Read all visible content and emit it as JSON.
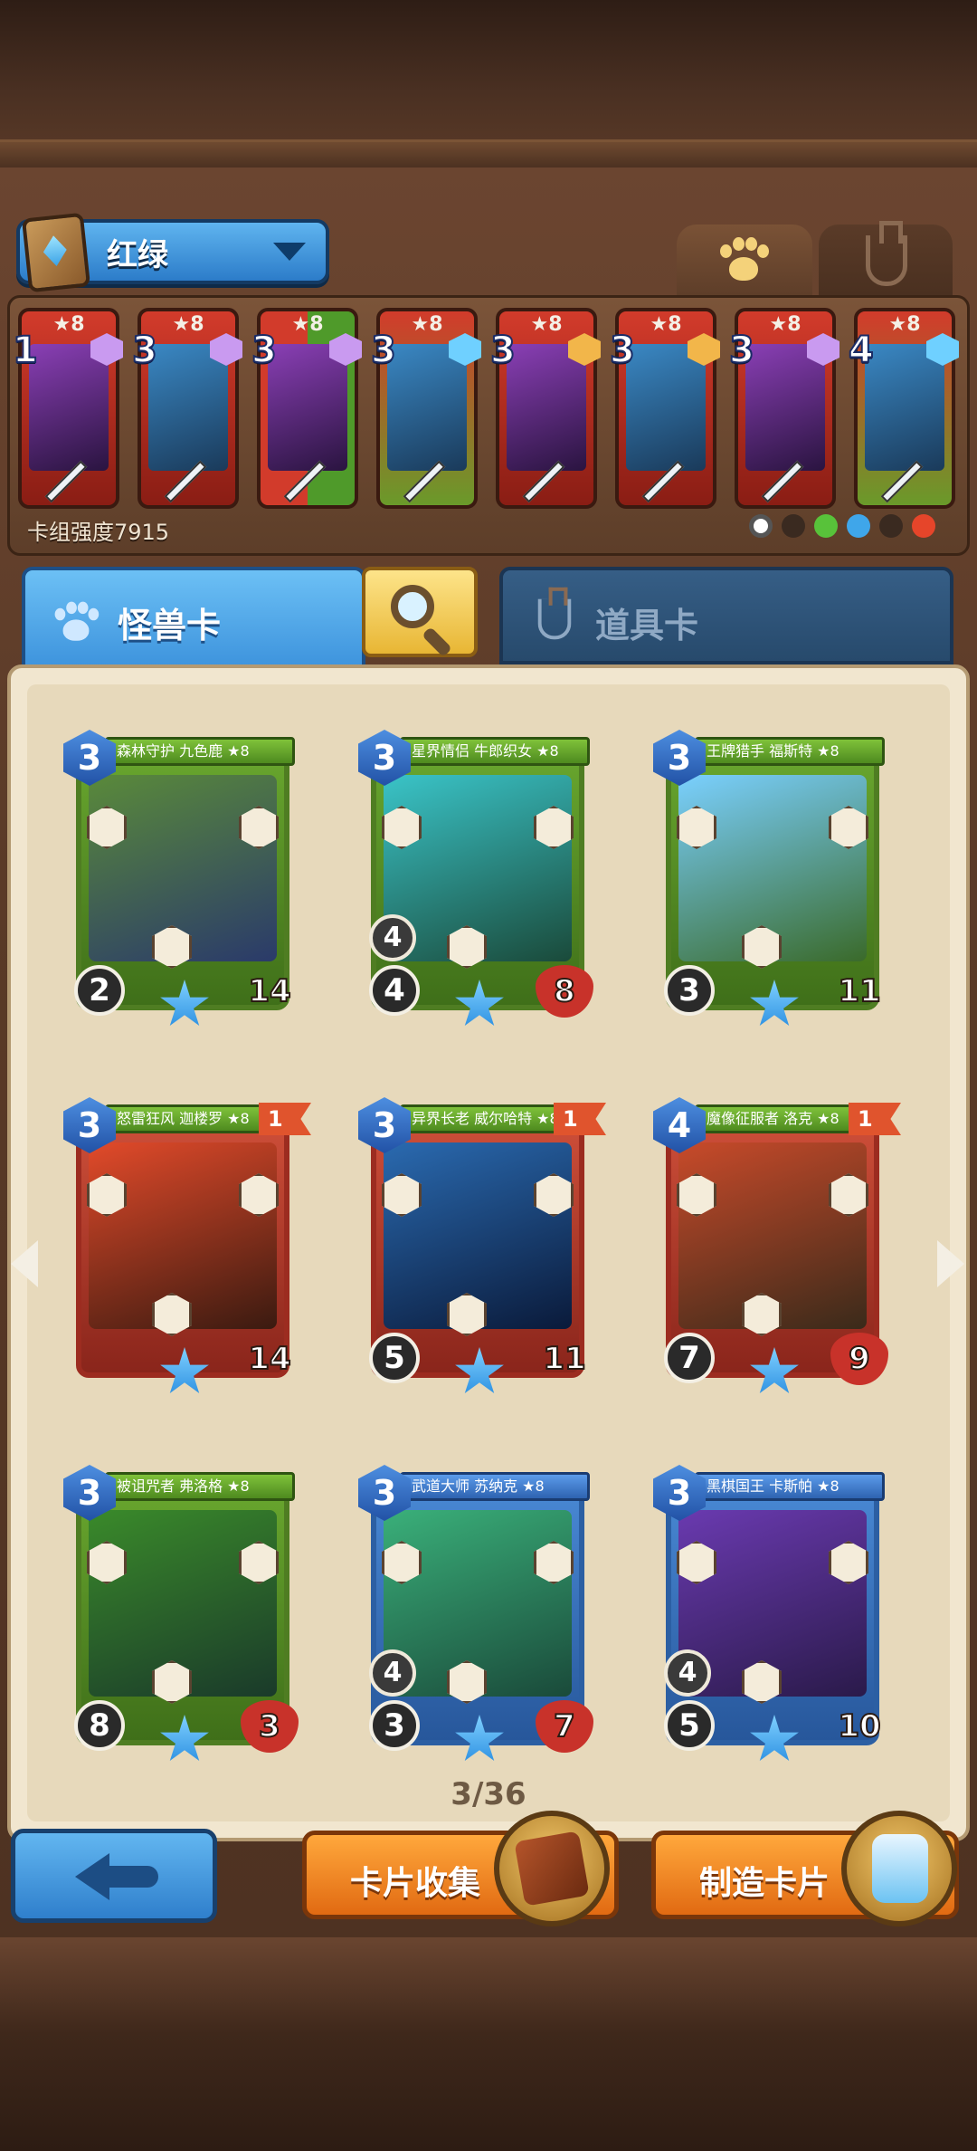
{
  "header": {
    "deck_name": "红绿",
    "deck_power_label": "卡组强度7915"
  },
  "deck": [
    {
      "cost": "1",
      "stars": "★8",
      "color": "red"
    },
    {
      "cost": "3",
      "stars": "★8",
      "color": "red"
    },
    {
      "cost": "3",
      "stars": "★8",
      "color": "redgreen"
    },
    {
      "cost": "3",
      "stars": "★8",
      "color": "green"
    },
    {
      "cost": "3",
      "stars": "★8",
      "color": "red"
    },
    {
      "cost": "3",
      "stars": "★8",
      "color": "red"
    },
    {
      "cost": "3",
      "stars": "★8",
      "color": "red"
    },
    {
      "cost": "4",
      "stars": "★8",
      "color": "green"
    }
  ],
  "tabs": {
    "monster": "怪兽卡",
    "item": "道具卡"
  },
  "cards": [
    {
      "cost": "3",
      "name": "森林守护 九色鹿 ★8",
      "frame": "green",
      "atk": "2",
      "hp": "14",
      "hp_style": "plain",
      "flag": "",
      "extra": ""
    },
    {
      "cost": "3",
      "name": "星界情侣 牛郎织女 ★8",
      "frame": "green",
      "atk": "4",
      "hp": "8",
      "hp_style": "heart",
      "flag": "",
      "extra": "4"
    },
    {
      "cost": "3",
      "name": "王牌猎手 福斯特 ★8",
      "frame": "green",
      "atk": "3",
      "hp": "11",
      "hp_style": "plain",
      "flag": "",
      "extra": ""
    },
    {
      "cost": "3",
      "name": "怒雷狂风 迦楼罗 ★8",
      "frame": "red",
      "atk": "",
      "hp": "14",
      "hp_style": "plain",
      "flag": "1",
      "extra": ""
    },
    {
      "cost": "3",
      "name": "异界长老 威尔哈特 ★8",
      "frame": "red",
      "atk": "5",
      "hp": "11",
      "hp_style": "plain",
      "flag": "1",
      "extra": ""
    },
    {
      "cost": "4",
      "name": "魔像征服者 洛克 ★8",
      "frame": "red",
      "atk": "7",
      "hp": "9",
      "hp_style": "heart",
      "flag": "1",
      "extra": ""
    },
    {
      "cost": "3",
      "name": "被诅咒者 弗洛格 ★8",
      "frame": "green",
      "atk": "8",
      "hp": "3",
      "hp_style": "heart",
      "flag": "",
      "extra": ""
    },
    {
      "cost": "3",
      "name": "武道大师 苏纳克 ★8",
      "frame": "blue",
      "atk": "3",
      "hp": "7",
      "hp_style": "heart",
      "flag": "",
      "extra": "4"
    },
    {
      "cost": "3",
      "name": "黑棋国王 卡斯帕 ★8",
      "frame": "blue",
      "atk": "5",
      "hp": "10",
      "hp_style": "plain",
      "flag": "",
      "extra": "4"
    }
  ],
  "pagination": {
    "label": "3/36"
  },
  "buttons": {
    "collect": "卡片收集",
    "craft": "制造卡片"
  },
  "colors": {
    "accent_blue": "#3c92dc",
    "accent_orange": "#e16a12",
    "frame_green": "#4f7d22",
    "frame_red": "#9c2c20",
    "frame_blue": "#2c5fa3"
  }
}
